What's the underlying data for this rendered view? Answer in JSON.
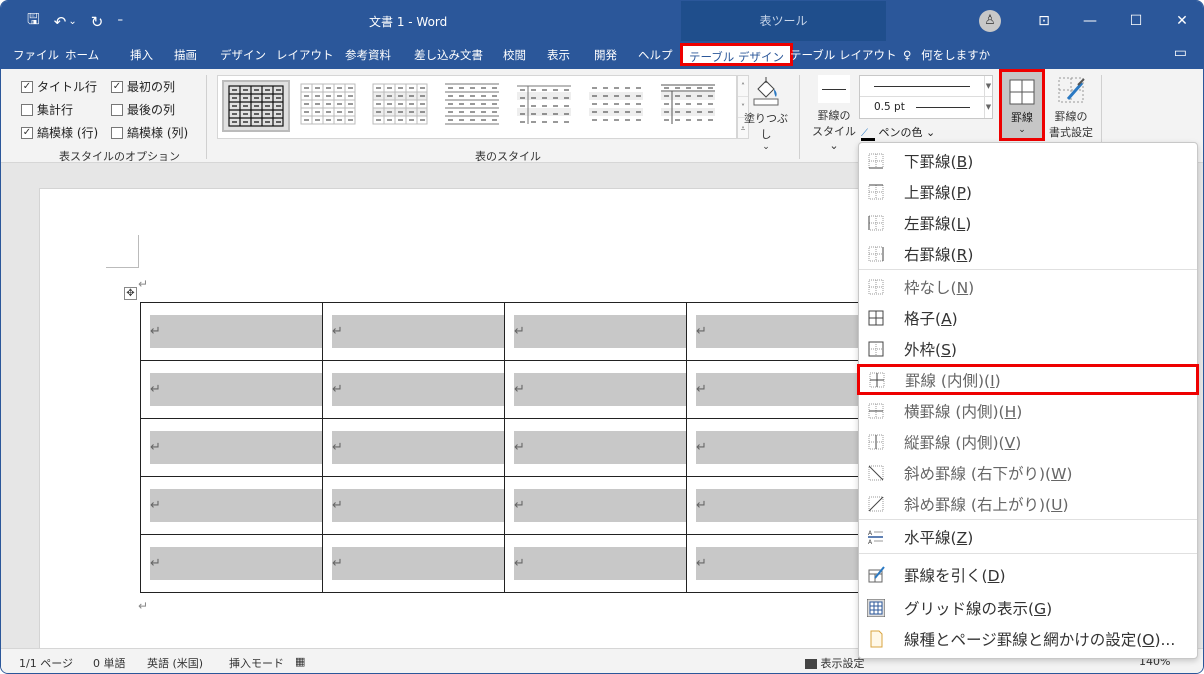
{
  "titlebar": {
    "title": "文書 1  -  Word",
    "context_tab_group": "表ツール",
    "qat": {
      "save_icon": "🖫",
      "undo_icon": "↶",
      "undo_dd": "⌄",
      "redo_icon": "↻",
      "customize": "⁼"
    },
    "avatar_icon": "♙",
    "ribbon_display_icon": "⊡",
    "minimize": "—",
    "maximize": "☐",
    "close": "✕"
  },
  "tabs": [
    {
      "label": "ファイル"
    },
    {
      "label": "ホーム"
    },
    {
      "label": "挿入"
    },
    {
      "label": "描画"
    },
    {
      "label": "デザイン"
    },
    {
      "label": "レイアウト"
    },
    {
      "label": "参考資料"
    },
    {
      "label": "差し込み文書"
    },
    {
      "label": "校閲"
    },
    {
      "label": "表示"
    },
    {
      "label": "開発"
    },
    {
      "label": "ヘルプ"
    },
    {
      "label": "テーブル デザイン",
      "active": true
    },
    {
      "label": "テーブル レイアウト"
    }
  ],
  "tell_me": {
    "icon": "♀",
    "label": "何をしますか"
  },
  "comment_icon": "▭",
  "ribbon": {
    "style_options": {
      "group_label": "表スタイルのオプション",
      "checkboxes": [
        {
          "label": "タイトル行",
          "checked": true
        },
        {
          "label": "最初の列",
          "checked": true
        },
        {
          "label": "集計行",
          "checked": false
        },
        {
          "label": "最後の列",
          "checked": false
        },
        {
          "label": "縞模様 (行)",
          "checked": true
        },
        {
          "label": "縞模様 (列)",
          "checked": false
        }
      ],
      "check_mark": "✓"
    },
    "table_styles": {
      "group_label": "表のスタイル",
      "scroll_up": "˄",
      "scroll_down": "˅",
      "more": "⩡"
    },
    "shading": {
      "label": "塗りつぶし",
      "dd": "⌄"
    },
    "border_style": {
      "label1": "罫線の",
      "label2": "スタイル ⌄"
    },
    "pen_weight": "0.5 pt",
    "pen_color": "ペンの色 ⌄",
    "borders": {
      "label": "罫線",
      "dd": "⌄"
    },
    "border_painter": {
      "label1": "罫線の",
      "label2": "書式設定"
    }
  },
  "document": {
    "para_mark": "↵",
    "move_handle": "✥",
    "rows": 5,
    "cols": 4
  },
  "statusbar": {
    "page": "1/1 ページ",
    "words": "0 単語",
    "language": "英語 (米国)",
    "mode": "挿入モード",
    "display_settings": "表示設定",
    "zoom": "140%"
  },
  "borders_menu": {
    "items": [
      {
        "label": "下罫線(",
        "key": "B",
        "suffix": ")",
        "icon": "bottom-border-icon",
        "dim": false
      },
      {
        "label": "上罫線(",
        "key": "P",
        "suffix": ")",
        "icon": "top-border-icon",
        "dim": false
      },
      {
        "label": "左罫線(",
        "key": "L",
        "suffix": ")",
        "icon": "left-border-icon",
        "dim": false
      },
      {
        "label": "右罫線(",
        "key": "R",
        "suffix": ")",
        "icon": "right-border-icon",
        "dim": false
      },
      {
        "label": "枠なし(",
        "key": "N",
        "suffix": ")",
        "icon": "no-border-icon",
        "dim": true
      },
      {
        "label": "格子(",
        "key": "A",
        "suffix": ")",
        "icon": "all-borders-icon",
        "dim": false
      },
      {
        "label": "外枠(",
        "key": "S",
        "suffix": ")",
        "icon": "outside-borders-icon",
        "dim": false
      },
      {
        "label": "罫線 (内側)(",
        "key": "I",
        "suffix": ")",
        "icon": "inside-borders-icon",
        "dim": true,
        "highlighted": true
      },
      {
        "label": "横罫線 (内側)(",
        "key": "H",
        "suffix": ")",
        "icon": "inside-horizontal-border-icon",
        "dim": true
      },
      {
        "label": "縦罫線 (内側)(",
        "key": "V",
        "suffix": ")",
        "icon": "inside-vertical-border-icon",
        "dim": true
      },
      {
        "label": "斜め罫線 (右下がり)(",
        "key": "W",
        "suffix": ")",
        "icon": "diagonal-down-border-icon",
        "dim": true
      },
      {
        "label": "斜め罫線 (右上がり)(",
        "key": "U",
        "suffix": ")",
        "icon": "diagonal-up-border-icon",
        "dim": true
      },
      {
        "label": "水平線(",
        "key": "Z",
        "suffix": ")",
        "icon": "horizontal-line-icon",
        "dim": false
      },
      {
        "label": "罫線を引く(",
        "key": "D",
        "suffix": ")",
        "icon": "draw-table-icon",
        "dim": false
      },
      {
        "label": "グリッド線の表示(",
        "key": "G",
        "suffix": ")",
        "icon": "view-gridlines-icon",
        "dim": false
      },
      {
        "label": "線種とページ罫線と網かけの設定(",
        "key": "O",
        "suffix": ")...",
        "icon": "borders-shading-icon",
        "dim": false
      }
    ]
  },
  "colors": {
    "brand": "#2b579a",
    "highlight_box": "#e00000",
    "cell_shade": "#c8c8c8"
  }
}
